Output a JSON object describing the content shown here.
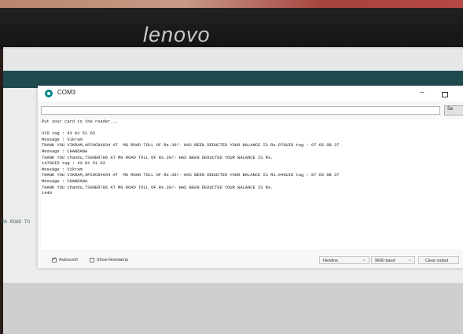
{
  "monitor": {
    "brand": "lenovo"
  },
  "ide": {
    "left_text": "MG ROAD TO"
  },
  "window": {
    "title": "COM3",
    "minimize_glyph": "–",
    "send_label": "Se",
    "send_value": ""
  },
  "output_lines": [
    "Put your card to the reader...",
    "",
    "UID tag : 43 01 51 D3",
    "Message : Vikram",
    "THANK YOU VIKRAM,AP29CB4934 AT  MG ROAD TOLL OF Rs.30/- HAS BEEN DEDUCTED YOUR BALANCE IS Rs.970UID tag : 07 66 0B 37",
    "Message : CHANDANA",
    "THANK YOU chandu,TS08ER786 AT MG ROAD TOLL OF Rs.30/- HAS BEEN DEDUCTED YOUR BALANCE IS Rs.",
    "1470UID tag : 43 01 51 D3",
    "Message : Vikram",
    "THANK YOU VIKRAM,AP29CB4934 AT  MG ROAD TOLL OF Rs.30/- HAS BEEN DEDUCTED YOUR BALANCE IS Rs.940UID tag : 07 66 0B 37",
    "Message : CHANDANA",
    "THANK YOU chandu,TS08ER786 AT MG ROAD TOLL OF Rs.30/- HAS BEEN DEDUCTED YOUR BALANCE IS Rs.",
    "1440"
  ],
  "status": {
    "autoscroll_label": "Autoscroll",
    "autoscroll_checked": true,
    "timestamp_label": "Show timestamp",
    "timestamp_checked": false,
    "line_ending": "Newline",
    "baud": "9600 baud",
    "clear_label": "Clear output"
  }
}
